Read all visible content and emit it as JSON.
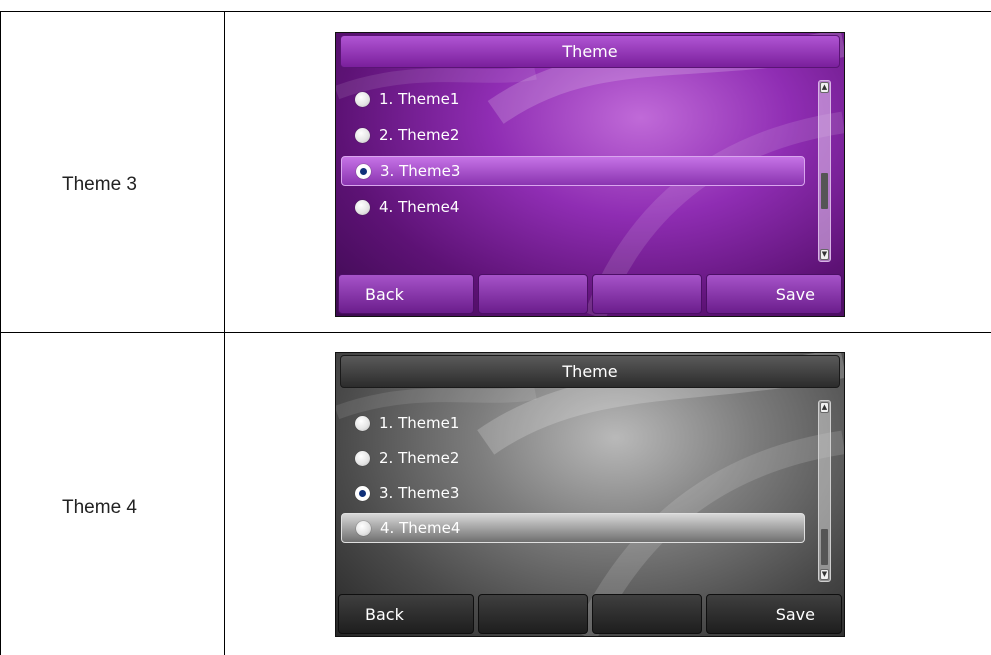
{
  "rows": [
    {
      "label": "Theme 3",
      "screen": {
        "title": "Theme",
        "items": [
          "1. Theme1",
          "2. Theme2",
          "3. Theme3",
          "4. Theme4"
        ],
        "selected_index": 2,
        "highlighted_index": 2,
        "softkeys": [
          "Back",
          "",
          "",
          "Save"
        ],
        "scroll_position": 0.75,
        "accent_color": "#8f2db3"
      }
    },
    {
      "label": "Theme 4",
      "screen": {
        "title": "Theme",
        "items": [
          "1. Theme1",
          "2. Theme2",
          "3. Theme3",
          "4. Theme4"
        ],
        "selected_index": 2,
        "highlighted_index": 3,
        "softkeys": [
          "Back",
          "",
          "",
          "Save"
        ],
        "scroll_position": 0.95,
        "accent_color": "#4a4a4a"
      }
    }
  ],
  "icons": {
    "radio_checked": "radio-checked-icon",
    "radio_unchecked": "radio-unchecked-icon",
    "scroll_up": "scroll-up-arrow-icon",
    "scroll_down": "scroll-down-arrow-icon"
  }
}
